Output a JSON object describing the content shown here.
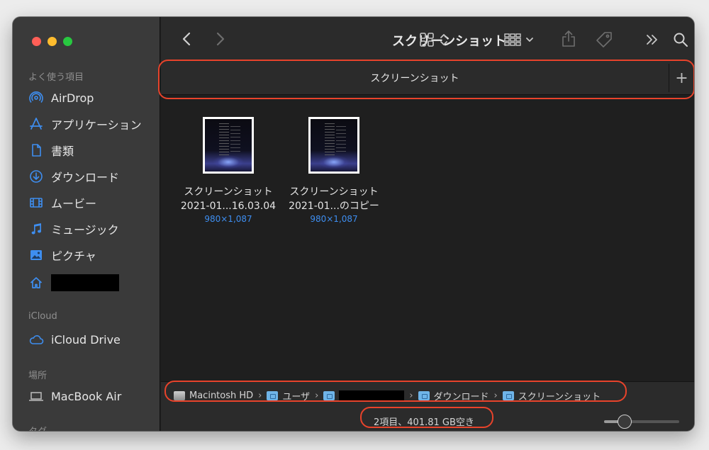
{
  "window": {
    "title": "スクリーンショット"
  },
  "sidebar": {
    "sections": [
      {
        "label": "よく使う項目"
      },
      {
        "label": "iCloud"
      },
      {
        "label": "場所"
      },
      {
        "label": "タグ"
      }
    ],
    "favorites": [
      {
        "label": "AirDrop",
        "icon": "airdrop-icon"
      },
      {
        "label": "アプリケーション",
        "icon": "applications-icon"
      },
      {
        "label": "書類",
        "icon": "document-icon"
      },
      {
        "label": "ダウンロード",
        "icon": "download-icon"
      },
      {
        "label": "ムービー",
        "icon": "film-icon"
      },
      {
        "label": "ミュージック",
        "icon": "music-note-icon"
      },
      {
        "label": "ピクチャ",
        "icon": "picture-icon"
      },
      {
        "label": "",
        "icon": "home-icon"
      }
    ],
    "icloud": [
      {
        "label": "iCloud Drive",
        "icon": "cloud-icon"
      }
    ],
    "locations": [
      {
        "label": "MacBook Air",
        "icon": "laptop-icon"
      }
    ]
  },
  "tabbar": {
    "tab_label": "スクリーンショット",
    "add_label": "+"
  },
  "files": [
    {
      "name_line1": "スクリーンショット",
      "name_line2": "2021-01...16.03.04",
      "dimensions": "980×1,087"
    },
    {
      "name_line1": "スクリーンショット",
      "name_line2": "2021-01...のコピー",
      "dimensions": "980×1,087"
    }
  ],
  "pathbar": {
    "crumbs": [
      "Macintosh HD",
      "ユーザ",
      "",
      "ダウンロード",
      "スクリーンショット"
    ],
    "separator": "›"
  },
  "status": {
    "text": "2項目、401.81 GB空き",
    "icon_size_fraction": 0.27
  },
  "colors": {
    "accent": "#3e8ef0",
    "highlight_ring": "#e8432b",
    "sidebar_icon": "#3e8ef0"
  }
}
